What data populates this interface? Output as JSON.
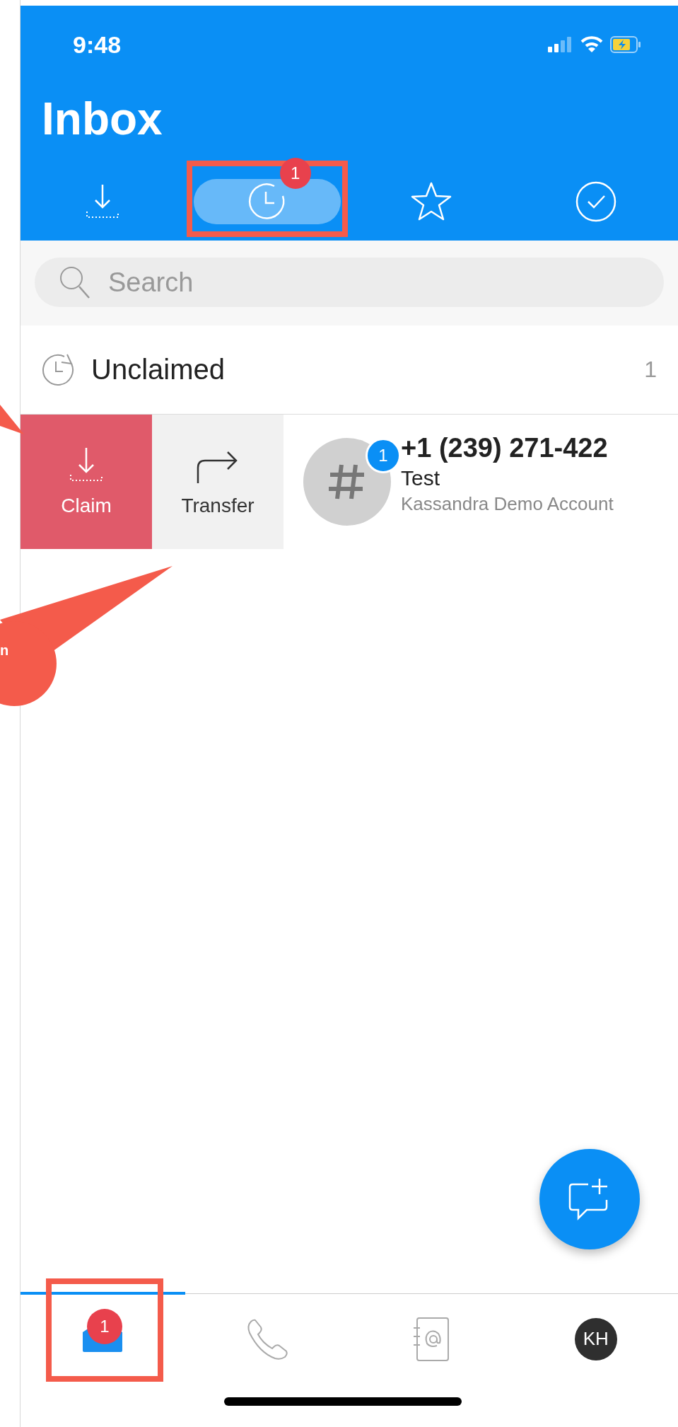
{
  "status_bar": {
    "time": "9:48"
  },
  "header": {
    "title": "Inbox"
  },
  "filter_tabs": [
    {
      "kind": "download",
      "selected": false
    },
    {
      "kind": "clock",
      "selected": true,
      "badge": "1",
      "highlighted": true
    },
    {
      "kind": "star",
      "selected": false
    },
    {
      "kind": "check",
      "selected": false
    }
  ],
  "search": {
    "placeholder": "Search"
  },
  "section": {
    "title": "Unclaimed",
    "count": "1"
  },
  "conversation": {
    "actions": [
      {
        "kind": "claim",
        "label": "Claim"
      },
      {
        "kind": "transfer",
        "label": "Transfer"
      }
    ],
    "badge": "1",
    "phone": "+1 (239) 271-422",
    "subject": "Test",
    "account": "Kassandra Demo Account"
  },
  "bottom_nav": [
    {
      "kind": "inbox",
      "selected": true,
      "badge": "1",
      "highlighted": true
    },
    {
      "kind": "phone",
      "selected": false
    },
    {
      "kind": "contacts",
      "selected": false
    },
    {
      "kind": "avatar",
      "selected": false,
      "initials": "KH"
    }
  ],
  "callout": {
    "text": "n"
  }
}
